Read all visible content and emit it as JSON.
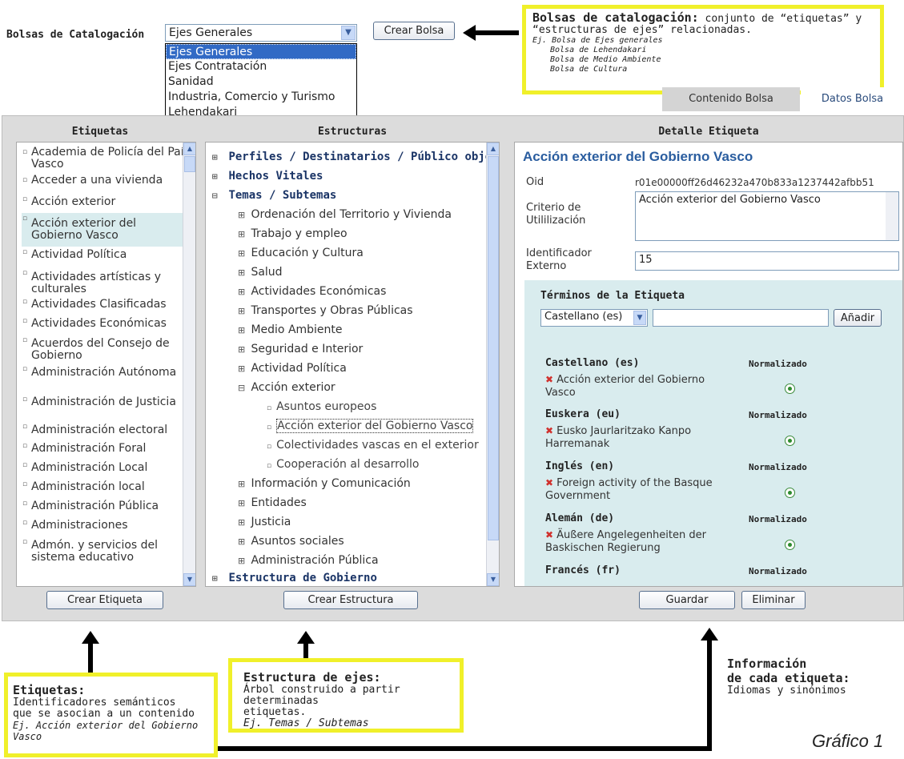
{
  "header": {
    "bolsas_label": "Bolsas de Catalogación",
    "select_value": "Ejes Generales",
    "dropdown_options": [
      "Ejes Generales",
      "Ejes Contratación",
      "Sanidad",
      "Industria, Comercio y Turismo",
      "Lehendakari"
    ],
    "crear_bolsa": "Crear Bolsa"
  },
  "callout_bolsas": {
    "title": "Bolsas de catalogación:",
    "text1": " conjunto de “etiquetas” y",
    "text2": "“estructuras de ejes” relacionadas.",
    "ex1": "Ej. Bolsa de Ejes generales",
    "ex2": "Bolsa de Lehendakari",
    "ex3": "Bolsa de Medio Ambiente",
    "ex4": "Bolsa de Cultura"
  },
  "tabs": {
    "contenido": "Contenido Bolsa",
    "datos": "Datos Bolsa"
  },
  "columns": {
    "etiquetas": "Etiquetas",
    "estructuras": "Estructuras",
    "detalle": "Detalle Etiqueta"
  },
  "etiquetas_list": [
    "Academia de Policía del País Vasco",
    "Acceder a una vivienda",
    "Acción exterior",
    "Acción exterior del Gobierno Vasco",
    "Actividad Política",
    "Actividades artísticas y culturales",
    "Actividades Clasificadas",
    "Actividades Económicas",
    "Acuerdos del Consejo de Gobierno",
    "Administración Autónoma",
    "Administración de Justicia",
    "Administración electoral",
    "Administración Foral",
    "Administración Local",
    "Administración local",
    "Administración Pública",
    "Administraciones",
    "Admón. y servicios del sistema educativo"
  ],
  "tree": {
    "perfiles": "Perfiles / Destinatarios / Público objetivo",
    "hechos": "Hechos Vitales",
    "temas": "Temas / Subtemas",
    "ordenacion": "Ordenación del Territorio y Vivienda",
    "trabajo": "Trabajo y empleo",
    "educacion": "Educación y Cultura",
    "salud": "Salud",
    "actividades_econ": "Actividades Económicas",
    "transportes": "Transportes y Obras Públicas",
    "medio": "Medio Ambiente",
    "seguridad": "Seguridad e Interior",
    "actividad_pol": "Actividad Política",
    "accion": "Acción exterior",
    "asuntos": "Asuntos europeos",
    "accion_gv": "Acción exterior del Gobierno Vasco",
    "colectividades": "Colectividades vascas en el exterior",
    "cooperacion": "Cooperación al desarrollo",
    "informacion": "Información y Comunicación",
    "entidades": "Entidades",
    "justicia": "Justicia",
    "asuntos_soc": "Asuntos sociales",
    "admin_pub": "Administración Pública",
    "estructura_gob": "Estructura de Gobierno"
  },
  "detalle": {
    "title": "Acción exterior del Gobierno Vasco",
    "oid_label": "Oid",
    "oid_value": "r01e00000ff26d46232a470b833a1237442afbb51",
    "criterio_label": "Criterio de Utililización",
    "criterio_value": "Acción exterior del Gobierno Vasco",
    "ident_label": "Identificador Externo",
    "ident_value": "15",
    "terminos_title": "Términos de la Etiqueta",
    "lang_select": "Castellano (es)",
    "anadir": "Añadir",
    "normalizado": "Normalizado",
    "terms": [
      {
        "lang": "Castellano (es)",
        "term": "Acción exterior del Gobierno Vasco"
      },
      {
        "lang": "Euskera (eu)",
        "term": "Eusko Jaurlaritzako Kanpo Harremanak"
      },
      {
        "lang": "Inglés (en)",
        "term": "Foreign activity of the Basque Government"
      },
      {
        "lang": "Alemán (de)",
        "term": "Äußere Angelegenheiten der Baskischen Regierung"
      },
      {
        "lang": "Francés (fr)",
        "term": ""
      }
    ]
  },
  "buttons": {
    "crear_etiqueta": "Crear Etiqueta",
    "crear_estructura": "Crear Estructura",
    "guardar": "Guardar",
    "eliminar": "Eliminar"
  },
  "callout_etiquetas": {
    "title": "Etiquetas:",
    "l1": "Identificadores semánticos",
    "l2": "que se asocian a un contenido",
    "ex1": "Ej. Acción exterior del Gobierno",
    "ex2": "Vasco"
  },
  "callout_estructura": {
    "title": "Estructura de ejes:",
    "l1": "Árbol construido a partir determinadas",
    "l2": "etiquetas.",
    "ex": "Ej. Temas / Subtemas"
  },
  "callout_info": {
    "t1": "Información",
    "t2": "de cada etiqueta:",
    "l1": "Idiomas y sinónimos"
  },
  "grafico": "Gráfico 1"
}
